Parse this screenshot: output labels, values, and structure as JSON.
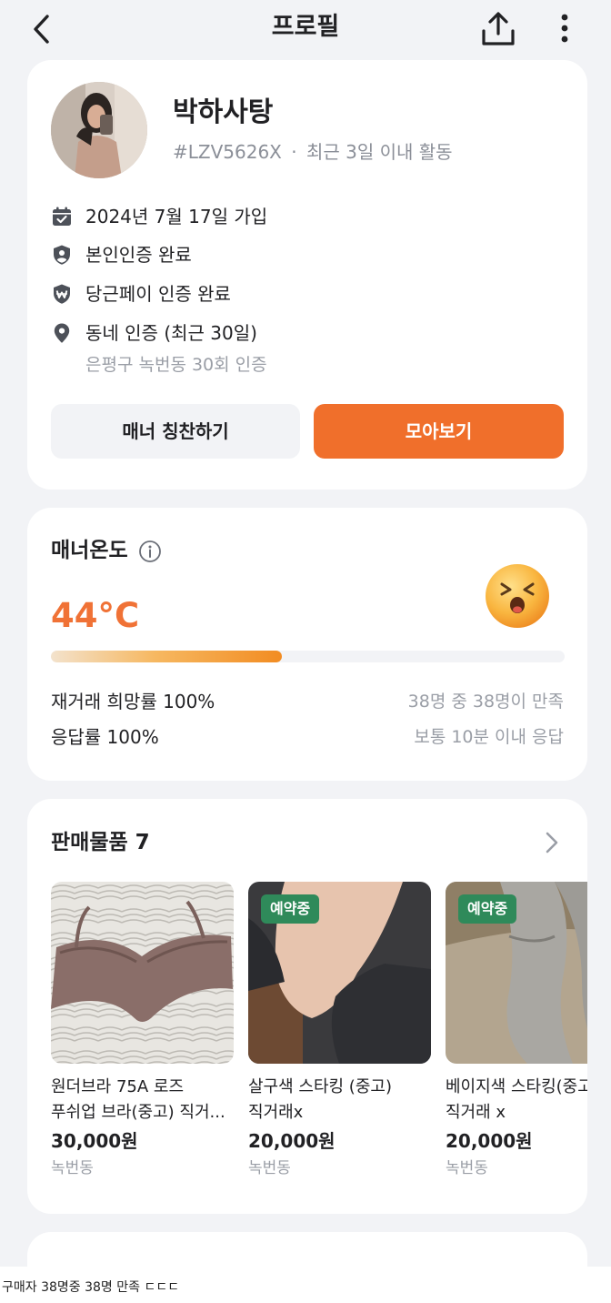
{
  "header": {
    "title": "프로필"
  },
  "profile": {
    "name": "박하사탕",
    "user_id": "#LZV5626X",
    "separator": "·",
    "activity": "최근 3일 이내 활동",
    "joined": "2024년 7월 17일 가입",
    "identity_verified": "본인인증 완료",
    "pay_verified": "당근페이 인증 완료",
    "neighborhood_verified": "동네 인증 (최근 30일)",
    "neighborhood_detail": "은평구 녹번동 30회 인증",
    "compliment_button": "매너 칭찬하기",
    "view_all_button": "모아보기"
  },
  "manner": {
    "title": "매너온도",
    "temperature": "44°C",
    "temperature_level": 0.45,
    "face_emoji": "laughing-face-icon",
    "rehire_label": "재거래 희망률 100%",
    "rehire_detail": "38명 중 38명이 만족",
    "response_label": "응답률 100%",
    "response_detail": "보통 10분 이내 응답"
  },
  "sales": {
    "title": "판매물품 7",
    "items": [
      {
        "title_line1": "원더브라 75A 로즈",
        "title_line2": "푸쉬업 브라(중고) 직거...",
        "price": "30,000원",
        "location": "녹번동",
        "badge": ""
      },
      {
        "title_line1": "살구색 스타킹 (중고)",
        "title_line2": "직거래x",
        "price": "20,000원",
        "location": "녹번동",
        "badge": "예약중"
      },
      {
        "title_line1": "베이지색 스타킹(중고)",
        "title_line2": "직거래 x",
        "price": "20,000원",
        "location": "녹번동",
        "badge": "예약중"
      }
    ]
  },
  "caption": "구매자 38명중 38명 만족 ㄷㄷㄷ",
  "colors": {
    "accent": "#f06f2b",
    "temperature": "#f07236",
    "badge": "#2f8a5a",
    "background": "#f2f3f6"
  }
}
